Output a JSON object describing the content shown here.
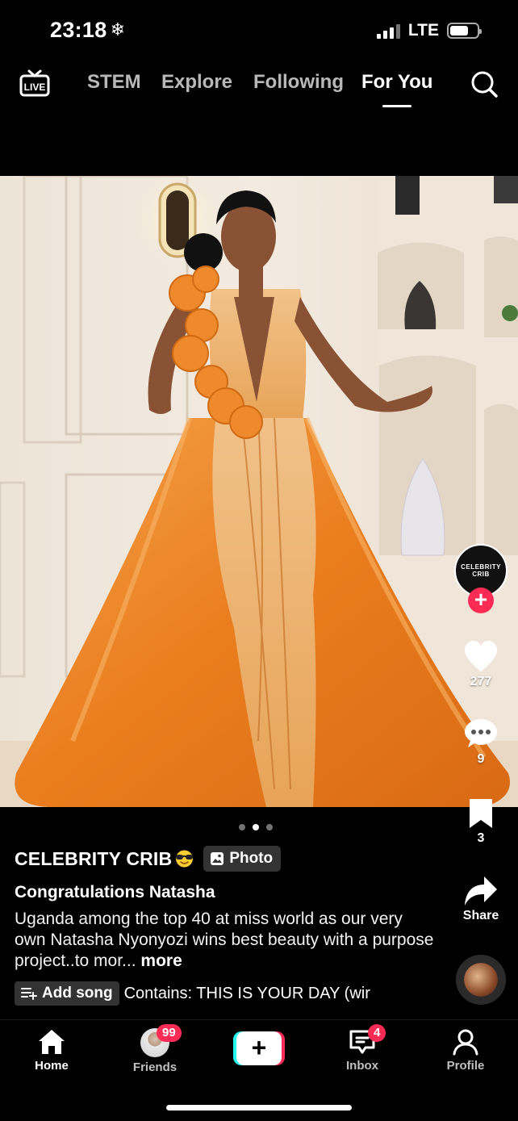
{
  "status_bar": {
    "time": "23:18",
    "time_icon": "snowflake-icon",
    "network": "LTE",
    "battery_level": 0.7
  },
  "top_nav": {
    "tabs": [
      {
        "label": "STEM",
        "active": false
      },
      {
        "label": "Explore",
        "active": false
      },
      {
        "label": "Following",
        "active": false
      },
      {
        "label": "For You",
        "active": true
      }
    ],
    "live_label": "LIVE"
  },
  "post": {
    "media_type": "photo",
    "slide_index": 2,
    "slide_total": 3,
    "creator_logo_text": "CELEBRITY CRIB",
    "likes": "277",
    "comments": "9",
    "saves": "3",
    "share_label": "Share",
    "author": "CELEBRITY CRIB",
    "author_emoji": "sunglasses-emoji",
    "badge_label": "Photo",
    "title": "Congratulations Natasha",
    "description": "Uganda among the top 40 at miss world as our very own Natasha Nyonyozi wins best beauty with a purpose project..to mor...",
    "more_label": "more",
    "add_song_label": "Add song",
    "contains_text": "Contains: THIS IS YOUR DAY (wir"
  },
  "bottom_nav": {
    "items": [
      {
        "label": "Home",
        "active": true
      },
      {
        "label": "Friends",
        "badge": "99"
      },
      {
        "label": ""
      },
      {
        "label": "Inbox",
        "badge": "4"
      },
      {
        "label": "Profile"
      }
    ]
  },
  "colors": {
    "accent_red": "#fe2c55",
    "accent_cyan": "#25f4ee",
    "dress_orange": "#f08a2a"
  }
}
